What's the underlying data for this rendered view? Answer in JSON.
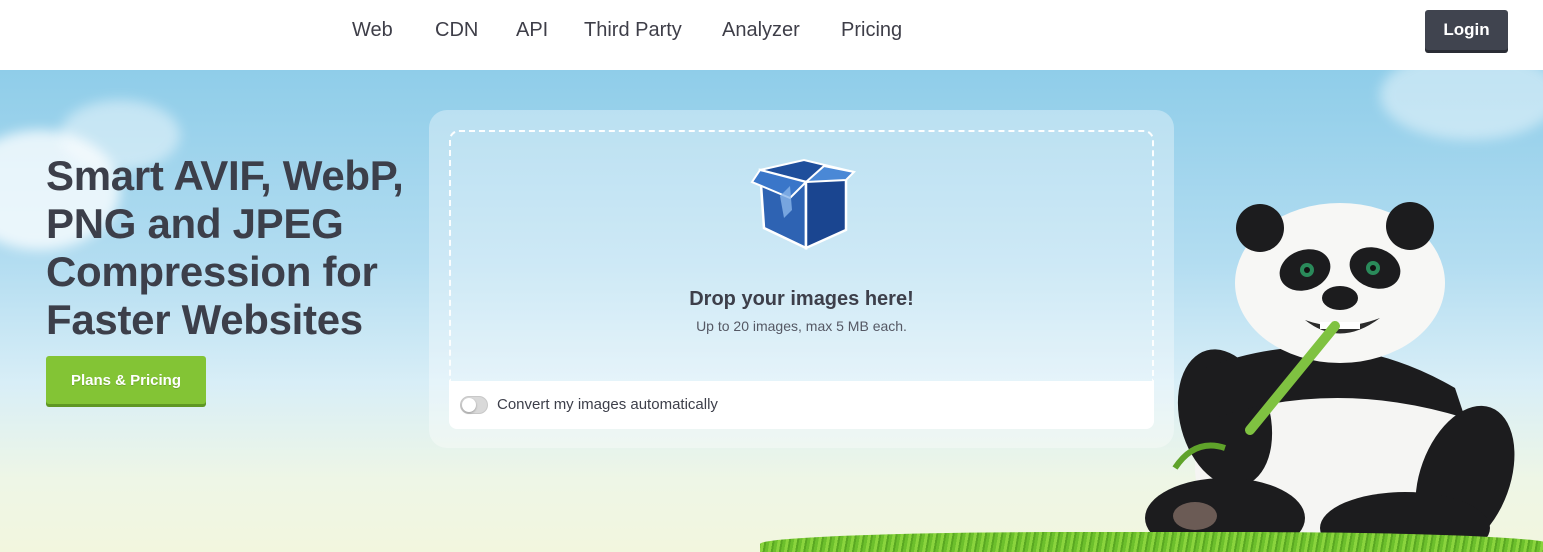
{
  "nav": {
    "links": [
      "Web",
      "CDN",
      "API",
      "Third Party",
      "Analyzer",
      "Pricing"
    ],
    "login_label": "Login"
  },
  "hero": {
    "headline_lines": [
      "Smart AVIF, WebP,",
      "PNG and JPEG",
      "Compression for",
      "Faster Websites"
    ],
    "plans_button": "Plans & Pricing"
  },
  "uploader": {
    "icon": "open-box-icon",
    "drop_title": "Drop your images here!",
    "drop_subtitle": "Up to 20 images, max 5 MB each.",
    "convert_label": "Convert my images automatically",
    "convert_enabled": false
  },
  "mascot": {
    "icon": "panda-mascot"
  },
  "colors": {
    "accent_green": "#83c435",
    "login_bg": "#40444f",
    "sky_top": "#8fcde9",
    "box_blue": "#2e63b3"
  }
}
